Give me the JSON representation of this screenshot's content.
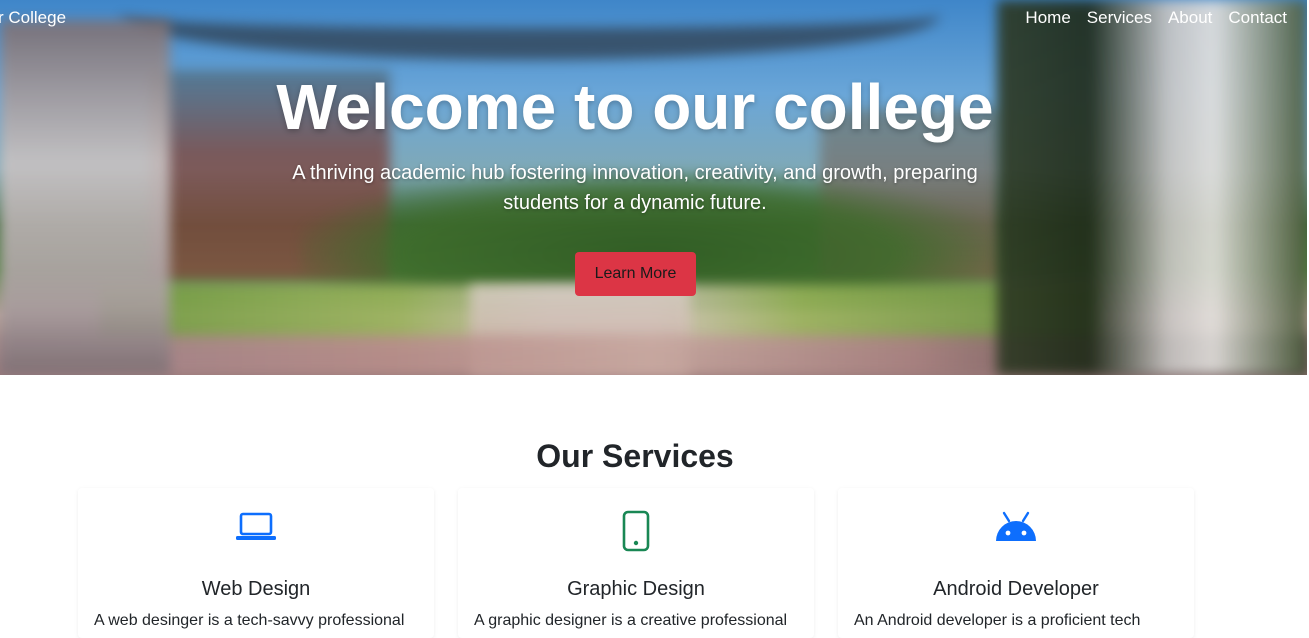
{
  "header": {
    "brand": "r College",
    "nav": [
      "Home",
      "Services",
      "About",
      "Contact"
    ]
  },
  "hero": {
    "title": "Welcome to our college",
    "subtitle": "A thriving academic hub fostering innovation, creativity, and growth, preparing students for a dynamic future.",
    "cta_label": "Learn More"
  },
  "services": {
    "title": "Our Services",
    "cards": [
      {
        "icon": "laptop-icon",
        "title": "Web Design",
        "text": "A web desinger is a tech-savvy professional"
      },
      {
        "icon": "phone-icon",
        "title": "Graphic Design",
        "text": "A graphic designer is a creative professional"
      },
      {
        "icon": "android-icon",
        "title": "Android Developer",
        "text": "An Android developer is a proficient tech"
      }
    ]
  },
  "colors": {
    "cta": "#dc3545",
    "icon_blue": "#0d6efd",
    "icon_green": "#198754"
  }
}
